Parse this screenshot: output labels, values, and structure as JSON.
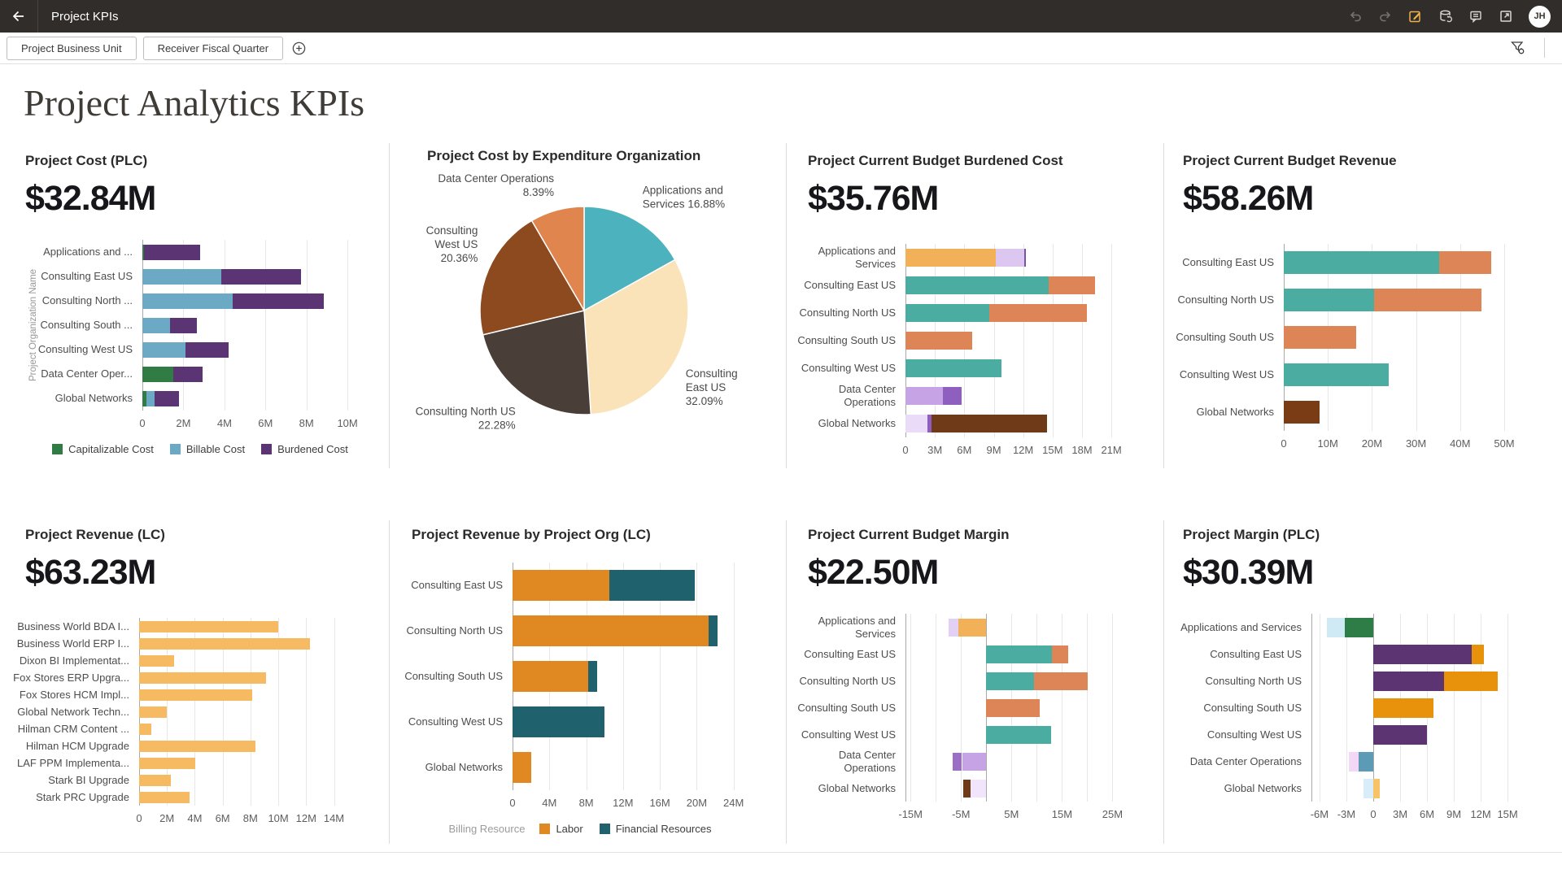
{
  "app_bar": {
    "title": "Project KPIs",
    "avatar_initials": "JH",
    "icons": [
      "back",
      "undo",
      "redo",
      "edit",
      "dataset-refresh",
      "comments",
      "open-in-new"
    ]
  },
  "filter_bar": {
    "chips": [
      "Project Business Unit",
      "Receiver Fiscal Quarter"
    ],
    "icons": [
      "add-filter",
      "filter-funnel"
    ]
  },
  "page": {
    "title": "Project Analytics KPIs"
  },
  "chart_data": [
    {
      "type": "stacked_bar_h",
      "title": "Project Cost (PLC)",
      "kpi": "$32.84M",
      "y_axis_label": "Project Organization Name",
      "xmin": 0,
      "xmax": 10.55,
      "grid": [
        0,
        2,
        4,
        6,
        8,
        10
      ],
      "ticks": [
        {
          "v": 0,
          "label": "0"
        },
        {
          "v": 2,
          "label": "2M"
        },
        {
          "v": 4,
          "label": "4M"
        },
        {
          "v": 6,
          "label": "6M"
        },
        {
          "v": 8,
          "label": "8M"
        },
        {
          "v": 10,
          "label": "10M"
        }
      ],
      "rows": [
        {
          "label": "Applications and ...",
          "segments": [
            {
              "v": 0.07,
              "c": "#317C45"
            },
            {
              "v": 2.75,
              "c": "#5B3573"
            }
          ]
        },
        {
          "label": "Consulting East US",
          "segments": [
            {
              "v": 3.85,
              "c": "#6BA9C5"
            },
            {
              "v": 3.9,
              "c": "#5B3573"
            }
          ]
        },
        {
          "label": "Consulting North ...",
          "segments": [
            {
              "v": 4.4,
              "c": "#6BA9C5"
            },
            {
              "v": 4.45,
              "c": "#5B3573"
            }
          ]
        },
        {
          "label": "Consulting South ...",
          "segments": [
            {
              "v": 1.35,
              "c": "#6BA9C5"
            },
            {
              "v": 1.3,
              "c": "#5B3573"
            }
          ]
        },
        {
          "label": "Consulting West US",
          "segments": [
            {
              "v": 2.1,
              "c": "#6BA9C5"
            },
            {
              "v": 2.1,
              "c": "#5B3573"
            }
          ]
        },
        {
          "label": "Data Center Oper...",
          "segments": [
            {
              "v": 1.5,
              "c": "#317C45"
            },
            {
              "v": 1.45,
              "c": "#5B3573"
            }
          ]
        },
        {
          "label": "Global Networks",
          "segments": [
            {
              "v": 0.2,
              "c": "#317C45"
            },
            {
              "v": 0.4,
              "c": "#6BA9C5"
            },
            {
              "v": 1.2,
              "c": "#5B3573"
            }
          ]
        }
      ],
      "legend": {
        "items": [
          {
            "label": "Capitalizable Cost",
            "c": "#317C45"
          },
          {
            "label": "Billable Cost",
            "c": "#6BA9C5"
          },
          {
            "label": "Burdened Cost",
            "c": "#5B3573"
          }
        ]
      }
    },
    {
      "type": "pie",
      "title": "Project Cost by Expenditure Organization",
      "slices": [
        {
          "label_lines": [
            "Applications and",
            "Services 16.88%"
          ],
          "value": 16.88,
          "c": "#4CB2BD"
        },
        {
          "label_lines": [
            "Consulting",
            "East US",
            "32.09%"
          ],
          "value": 32.09,
          "c": "#FAE3B8"
        },
        {
          "label_lines": [
            "Consulting North US",
            "22.28%"
          ],
          "value": 22.28,
          "c": "#4A3F38"
        },
        {
          "label_lines": [
            "Consulting",
            "West US",
            "20.36%"
          ],
          "value": 20.36,
          "c": "#8C4A1E"
        },
        {
          "label_lines": [
            "Data Center Operations",
            "8.39%"
          ],
          "value": 8.39,
          "c": "#E0854D"
        }
      ]
    },
    {
      "type": "stacked_bar_h",
      "title": "Project Current Budget Burdened Cost",
      "kpi": "$35.76M",
      "xmin": 0,
      "xmax": 22.4,
      "grid": [
        0,
        3,
        6,
        9,
        12,
        15,
        18,
        21
      ],
      "ticks": [
        {
          "v": 0,
          "label": "0"
        },
        {
          "v": 3,
          "label": "3M"
        },
        {
          "v": 6,
          "label": "6M"
        },
        {
          "v": 9,
          "label": "9M"
        },
        {
          "v": 12,
          "label": "12M"
        },
        {
          "v": 15,
          "label": "15M"
        },
        {
          "v": 18,
          "label": "18M"
        },
        {
          "v": 21,
          "label": "21M"
        }
      ],
      "rows": [
        {
          "label": "Applications and",
          "label2": "Services",
          "segments": [
            {
              "v": 9.2,
              "c": "#F2B159"
            },
            {
              "v": 2.9,
              "c": "#DCC7F0"
            },
            {
              "v": 0.2,
              "c": "#7B52A8"
            }
          ]
        },
        {
          "label": "Consulting East US",
          "segments": [
            {
              "v": 14.6,
              "c": "#4BACA1"
            },
            {
              "v": 4.7,
              "c": "#DD8557"
            }
          ]
        },
        {
          "label": "Consulting North US",
          "segments": [
            {
              "v": 8.5,
              "c": "#4BACA1"
            },
            {
              "v": 10.0,
              "c": "#DD8557"
            }
          ]
        },
        {
          "label": "Consulting South US",
          "segments": [
            {
              "v": 6.8,
              "c": "#DD8557"
            }
          ]
        },
        {
          "label": "Consulting West US",
          "segments": [
            {
              "v": 9.8,
              "c": "#4BACA1"
            }
          ]
        },
        {
          "label": "Data Center",
          "label2": "Operations",
          "segments": [
            {
              "v": 3.8,
              "c": "#C5A3E5"
            },
            {
              "v": 1.9,
              "c": "#8E5FBE"
            }
          ]
        },
        {
          "label": "Global Networks",
          "segments": [
            {
              "v": 2.2,
              "c": "#EADCF8"
            },
            {
              "v": 0.45,
              "c": "#8E5FBE"
            },
            {
              "v": 11.8,
              "c": "#6E3A18"
            }
          ]
        }
      ]
    },
    {
      "type": "stacked_bar_h",
      "title": "Project Current Budget Revenue",
      "kpi": "$58.26M",
      "xmin": 0,
      "xmax": 53.5,
      "grid": [
        0,
        10,
        20,
        30,
        40,
        50
      ],
      "ticks": [
        {
          "v": 0,
          "label": "0"
        },
        {
          "v": 10,
          "label": "10M"
        },
        {
          "v": 20,
          "label": "20M"
        },
        {
          "v": 30,
          "label": "30M"
        },
        {
          "v": 40,
          "label": "40M"
        },
        {
          "v": 50,
          "label": "50M"
        }
      ],
      "rows": [
        {
          "label": "Consulting East US",
          "segments": [
            {
              "v": 35.2,
              "c": "#4BACA1"
            },
            {
              "v": 11.9,
              "c": "#DD8557"
            }
          ]
        },
        {
          "label": "Consulting North US",
          "segments": [
            {
              "v": 20.4,
              "c": "#4BACA1"
            },
            {
              "v": 24.4,
              "c": "#DD8557"
            }
          ]
        },
        {
          "label": "Consulting South US",
          "segments": [
            {
              "v": 16.4,
              "c": "#DD8557"
            }
          ]
        },
        {
          "label": "Consulting West US",
          "segments": [
            {
              "v": 23.8,
              "c": "#4BACA1"
            }
          ]
        },
        {
          "label": "Global Networks",
          "segments": [
            {
              "v": 8.1,
              "c": "#7A3C14"
            }
          ]
        }
      ]
    },
    {
      "type": "stacked_bar_h",
      "title": "Project Revenue (LC)",
      "kpi": "$63.23M",
      "xmin": 0,
      "xmax": 15.2,
      "grid": [
        0,
        2,
        4,
        6,
        8,
        10,
        12,
        14
      ],
      "ticks": [
        {
          "v": 0,
          "label": "0"
        },
        {
          "v": 2,
          "label": "2M"
        },
        {
          "v": 4,
          "label": "4M"
        },
        {
          "v": 6,
          "label": "6M"
        },
        {
          "v": 8,
          "label": "8M"
        },
        {
          "v": 10,
          "label": "10M"
        },
        {
          "v": 12,
          "label": "12M"
        },
        {
          "v": 14,
          "label": "14M"
        }
      ],
      "rows": [
        {
          "label": "Business World BDA I...",
          "segments": [
            {
              "v": 10.0,
              "c": "#F6BB62"
            }
          ]
        },
        {
          "label": "Business World ERP I...",
          "segments": [
            {
              "v": 12.3,
              "c": "#F6BB62"
            }
          ]
        },
        {
          "label": "Dixon BI Implementat...",
          "segments": [
            {
              "v": 2.5,
              "c": "#F6BB62"
            }
          ]
        },
        {
          "label": "Fox Stores ERP Upgra...",
          "segments": [
            {
              "v": 9.1,
              "c": "#F6BB62"
            }
          ]
        },
        {
          "label": "Fox Stores HCM Impl...",
          "segments": [
            {
              "v": 8.15,
              "c": "#F6BB62"
            }
          ]
        },
        {
          "label": "Global Network Techn...",
          "segments": [
            {
              "v": 2.0,
              "c": "#F6BB62"
            }
          ]
        },
        {
          "label": "Hilman CRM Content ...",
          "segments": [
            {
              "v": 0.85,
              "c": "#F6BB62"
            }
          ]
        },
        {
          "label": "Hilman HCM Upgrade",
          "segments": [
            {
              "v": 8.35,
              "c": "#F6BB62"
            }
          ]
        },
        {
          "label": "LAF PPM Implementa...",
          "segments": [
            {
              "v": 4.05,
              "c": "#F6BB62"
            }
          ]
        },
        {
          "label": "Stark BI Upgrade",
          "segments": [
            {
              "v": 2.3,
              "c": "#F6BB62"
            }
          ]
        },
        {
          "label": "Stark PRC Upgrade",
          "segments": [
            {
              "v": 3.6,
              "c": "#F6BB62"
            }
          ]
        }
      ]
    },
    {
      "type": "stacked_bar_h",
      "title": "Project Revenue by Project Org (LC)",
      "xmin": 0,
      "xmax": 26.5,
      "grid": [
        0,
        4,
        8,
        12,
        16,
        20,
        24
      ],
      "ticks": [
        {
          "v": 0,
          "label": "0"
        },
        {
          "v": 4,
          "label": "4M"
        },
        {
          "v": 8,
          "label": "8M"
        },
        {
          "v": 12,
          "label": "12M"
        },
        {
          "v": 16,
          "label": "16M"
        },
        {
          "v": 20,
          "label": "20M"
        },
        {
          "v": 24,
          "label": "24M"
        }
      ],
      "rows": [
        {
          "label": "Consulting East US",
          "segments": [
            {
              "v": 10.5,
              "c": "#E08821"
            },
            {
              "v": 9.3,
              "c": "#20616E"
            }
          ]
        },
        {
          "label": "Consulting North US",
          "segments": [
            {
              "v": 21.3,
              "c": "#E08821"
            },
            {
              "v": 1.0,
              "c": "#20616E"
            }
          ]
        },
        {
          "label": "Consulting South US",
          "segments": [
            {
              "v": 8.2,
              "c": "#E08821"
            },
            {
              "v": 1.0,
              "c": "#20616E"
            }
          ]
        },
        {
          "label": "Consulting West US",
          "segments": [
            {
              "v": 10.0,
              "c": "#20616E"
            }
          ]
        },
        {
          "label": "Global Networks",
          "segments": [
            {
              "v": 2.0,
              "c": "#E08821"
            }
          ]
        }
      ],
      "legend": {
        "title": "Billing Resource",
        "items": [
          {
            "label": "Labor",
            "c": "#E08821"
          },
          {
            "label": "Financial Resources",
            "c": "#20616E"
          }
        ]
      }
    },
    {
      "type": "stacked_bar_h",
      "title": "Project Current Budget Margin",
      "kpi": "$22.50M",
      "xmin": -16,
      "xmax": 28.8,
      "edge_line": true,
      "grid": [
        -15,
        -10,
        -5,
        0,
        5,
        10,
        15,
        20,
        25
      ],
      "ticks": [
        {
          "v": -15,
          "label": "-15M"
        },
        {
          "v": -5,
          "label": "-5M"
        },
        {
          "v": 5,
          "label": "5M"
        },
        {
          "v": 15,
          "label": "15M"
        },
        {
          "v": 25,
          "label": "25M"
        }
      ],
      "rows": [
        {
          "label": "Applications and",
          "label2": "Services",
          "segments": [
            {
              "v": -5.5,
              "c": "#F2B159"
            },
            {
              "v": -2.0,
              "c": "#E3D1F5"
            }
          ]
        },
        {
          "label": "Consulting East US",
          "segments": [
            {
              "v": 13.0,
              "c": "#4BACA1"
            },
            {
              "v": 3.2,
              "c": "#DD8557"
            }
          ]
        },
        {
          "label": "Consulting North US",
          "segments": [
            {
              "v": 9.5,
              "c": "#4BACA1"
            },
            {
              "v": 10.6,
              "c": "#DD8557"
            }
          ]
        },
        {
          "label": "Consulting South US",
          "segments": [
            {
              "v": 10.6,
              "c": "#DD8557"
            }
          ]
        },
        {
          "label": "Consulting West US",
          "segments": [
            {
              "v": 12.9,
              "c": "#4BACA1"
            }
          ]
        },
        {
          "label": "Data Center",
          "label2": "Operations",
          "segments": [
            {
              "v": -4.8,
              "c": "#C5A3E5"
            },
            {
              "v": -1.9,
              "c": "#9B6FC4"
            }
          ]
        },
        {
          "label": "Global Networks",
          "segments": [
            {
              "v": -3.1,
              "c": "#F0E5FB"
            },
            {
              "v": -1.5,
              "c": "#6E3A18"
            }
          ]
        }
      ]
    },
    {
      "type": "stacked_bar_h",
      "title": "Project Margin (PLC)",
      "kpi": "$30.39M",
      "xmin": -6.9,
      "xmax": 16.9,
      "edge_line": true,
      "grid": [
        -6,
        -3,
        0,
        3,
        6,
        9,
        12,
        15
      ],
      "ticks": [
        {
          "v": -6,
          "label": "-6M"
        },
        {
          "v": -3,
          "label": "-3M"
        },
        {
          "v": 0,
          "label": "0"
        },
        {
          "v": 3,
          "label": "3M"
        },
        {
          "v": 6,
          "label": "6M"
        },
        {
          "v": 9,
          "label": "9M"
        },
        {
          "v": 12,
          "label": "12M"
        },
        {
          "v": 15,
          "label": "15M"
        }
      ],
      "rows": [
        {
          "label": "Applications and Services",
          "segments": [
            {
              "v": -3.2,
              "c": "#2E7D46"
            },
            {
              "v": -2.0,
              "c": "#CFE9F5"
            }
          ]
        },
        {
          "label": "Consulting East US",
          "segments": [
            {
              "v": 11.0,
              "c": "#5C3472"
            },
            {
              "v": 1.4,
              "c": "#E8920C"
            }
          ]
        },
        {
          "label": "Consulting North US",
          "segments": [
            {
              "v": 7.9,
              "c": "#5C3472"
            },
            {
              "v": 6.0,
              "c": "#E8920C"
            }
          ]
        },
        {
          "label": "Consulting South US",
          "segments": [
            {
              "v": 6.7,
              "c": "#E8920C"
            }
          ]
        },
        {
          "label": "Consulting West US",
          "segments": [
            {
              "v": 6.0,
              "c": "#5C3472"
            }
          ]
        },
        {
          "label": "Data Center Operations",
          "segments": [
            {
              "v": -1.6,
              "c": "#5B9BB5"
            },
            {
              "v": -1.1,
              "c": "#F2D7F7"
            }
          ]
        },
        {
          "label": "Global Networks",
          "segments": [
            {
              "v": -1.1,
              "c": "#D8EDF8"
            },
            {
              "v": 0.7,
              "c": "#F7C268"
            }
          ]
        }
      ]
    }
  ]
}
